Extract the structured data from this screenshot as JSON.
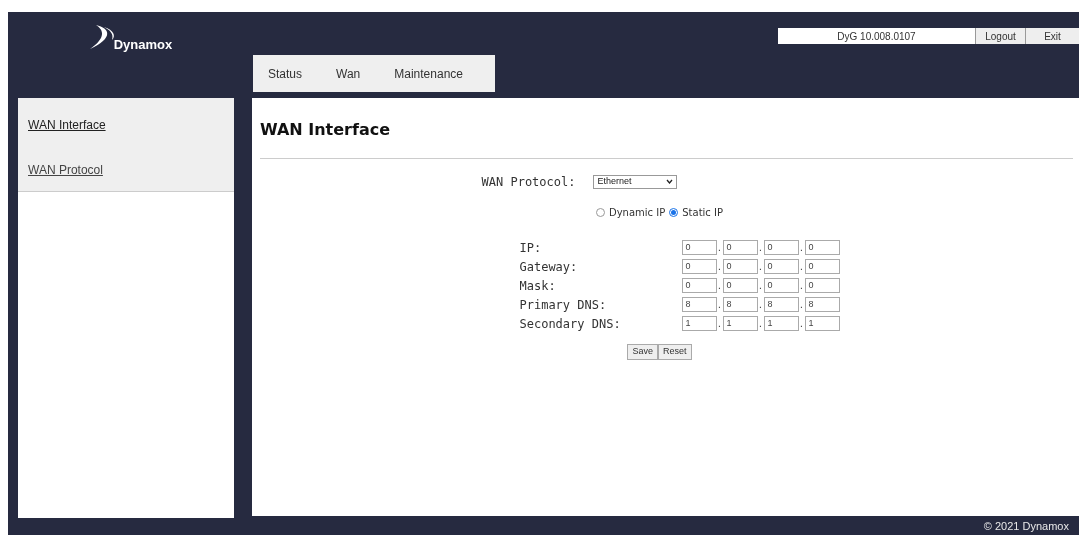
{
  "logo": {
    "text": "Dynamox"
  },
  "header": {
    "version": "DyG 10.008.0107",
    "buttons": [
      "Logout",
      "Exit"
    ]
  },
  "tabs": [
    {
      "label": "Status",
      "selected": false
    },
    {
      "label": "Wan",
      "selected": false
    },
    {
      "label": "Maintenance",
      "selected": false
    }
  ],
  "sidebar": {
    "items": [
      {
        "label": "WAN Interface",
        "selected": true
      },
      {
        "label": "WAN Protocol",
        "selected": false
      }
    ]
  },
  "page": {
    "title": "WAN Interface",
    "protocol": {
      "label": "WAN Protocol:",
      "value": "Ethernet"
    },
    "modes": [
      {
        "label": "Dynamic IP",
        "selected": false
      },
      {
        "label": "Static IP",
        "selected": true
      }
    ],
    "separator": ".",
    "fields": [
      {
        "label": "IP:",
        "octets": [
          "0",
          "0",
          "0",
          "0"
        ]
      },
      {
        "label": "Gateway:",
        "octets": [
          "0",
          "0",
          "0",
          "0"
        ]
      },
      {
        "label": "Mask:",
        "octets": [
          "0",
          "0",
          "0",
          "0"
        ]
      },
      {
        "label": "Primary DNS:",
        "octets": [
          "8",
          "8",
          "8",
          "8"
        ]
      },
      {
        "label": "Secondary DNS:",
        "octets": [
          "1",
          "1",
          "1",
          "1"
        ]
      }
    ],
    "buttons": [
      "Save",
      "Reset"
    ]
  },
  "footer": "© 2021 Dynamox"
}
